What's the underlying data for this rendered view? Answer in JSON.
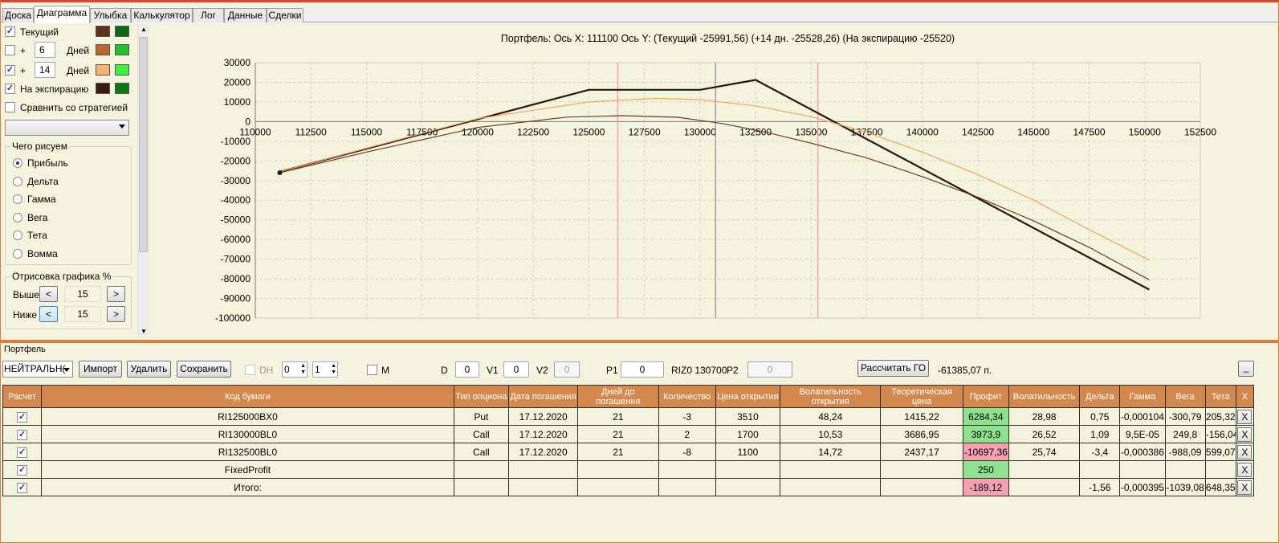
{
  "tabs": [
    "Доска",
    "Диаграмма",
    "Улыбка",
    "Калькулятор",
    "Лог",
    "Данные",
    "Сделки"
  ],
  "left": {
    "rows": [
      {
        "checked": true,
        "label": "Текущий",
        "c1": "#5b3418",
        "c2": "#0b6b14"
      },
      {
        "checked": false,
        "plus": "+",
        "days": "6",
        "label": "Дней",
        "c1": "#b8652f",
        "c2": "#1fc22a"
      },
      {
        "checked": true,
        "plus": "+",
        "days": "14",
        "label": "Дней",
        "c1": "#f8b06a",
        "c2": "#43f03c"
      },
      {
        "checked": true,
        "label": "На экспирацию",
        "c1": "#3a1d0e",
        "c2": "#0b7a16"
      }
    ],
    "compare_label": "Сравнить со стратегией",
    "draw_group": "Чего рисуем",
    "radios": [
      "Прибыль",
      "Дельта",
      "Гамма",
      "Вега",
      "Тета",
      "Вомма"
    ],
    "draw_pct_group": "Отрисовка графика %",
    "above_label": "Выше",
    "below_label": "Ниже",
    "above_val": "15",
    "below_val": "15",
    "lt": "<",
    "gt": ">"
  },
  "chart_data": {
    "type": "line",
    "title": "Портфель: Ось X: 111100 Ось Y:  (Текущий -25991,56)  (+14 дн. -25528,26)  (На экспирацию -25520)",
    "xlim": [
      110000,
      152500
    ],
    "ylim": [
      -100000,
      30000
    ],
    "xticks": [
      110000,
      112500,
      115000,
      117500,
      120000,
      122500,
      125000,
      127500,
      130000,
      132500,
      135000,
      137500,
      140000,
      142500,
      145000,
      147500,
      150000,
      152500
    ],
    "yticks": [
      30000,
      20000,
      10000,
      0,
      -10000,
      -20000,
      -30000,
      -40000,
      -50000,
      -60000,
      -70000,
      -80000,
      -90000,
      -100000
    ],
    "vlines": [
      {
        "x": 126300,
        "color": "#f0a0a0"
      },
      {
        "x": 130700,
        "color": "#9999aa"
      },
      {
        "x": 135300,
        "color": "#f0a0a0"
      }
    ],
    "series": [
      {
        "color": "#2a1608",
        "width": 2.2,
        "points": [
          [
            111100,
            -25520
          ],
          [
            125000,
            16200
          ],
          [
            130000,
            16200
          ],
          [
            132500,
            21200
          ],
          [
            150200,
            -85500
          ]
        ]
      },
      {
        "color": "#f5a25a",
        "width": 1.2,
        "points": [
          [
            111100,
            -25528
          ],
          [
            115000,
            -13500
          ],
          [
            120000,
            1500
          ],
          [
            125000,
            10000
          ],
          [
            128000,
            11800
          ],
          [
            130000,
            11200
          ],
          [
            132500,
            8000
          ],
          [
            135000,
            2500
          ],
          [
            137500,
            -5500
          ],
          [
            140000,
            -15500
          ],
          [
            142500,
            -27000
          ],
          [
            145000,
            -40000
          ],
          [
            147500,
            -55000
          ],
          [
            150200,
            -70500
          ]
        ]
      },
      {
        "color": "#6b3a1c",
        "width": 1.2,
        "points": [
          [
            111100,
            -25991
          ],
          [
            115000,
            -15500
          ],
          [
            120000,
            -3000
          ],
          [
            124000,
            2300
          ],
          [
            126500,
            3000
          ],
          [
            129000,
            2200
          ],
          [
            131000,
            -1000
          ],
          [
            133000,
            -5500
          ],
          [
            135000,
            -11000
          ],
          [
            137500,
            -18500
          ],
          [
            140000,
            -28000
          ],
          [
            142500,
            -38500
          ],
          [
            145000,
            -50500
          ],
          [
            147500,
            -64000
          ],
          [
            150200,
            -80500
          ]
        ]
      }
    ],
    "marker": [
      111100,
      -25991
    ]
  },
  "toolbar": {
    "strategy": "НЕЙТРАЛЬН(",
    "import": "Импорт",
    "delete": "Удалить",
    "save": "Сохранить",
    "dh": "DH",
    "spin1": "0",
    "spin2": "1",
    "m": "M",
    "d_label": "D",
    "d_val": "0",
    "v1_label": "V1",
    "v1_val": "0",
    "v2_label": "V2",
    "v2_val": "0",
    "p1_label": "P1",
    "p1_val": "0",
    "riz": "RIZ0 130700",
    "p2_label": "P2",
    "p2_val": "0",
    "calc_go": "Рассчитать ГО",
    "go_value": "-61385,07 п.",
    "min": "_"
  },
  "portfolio_label": "Портфель",
  "table": {
    "headers": [
      "Расчет",
      "Код бумаги",
      "Тип опциона",
      "Дата погашения",
      "Дней до погашения",
      "Количество",
      "Цена открытия",
      "Волатильность открытия",
      "Теоретическая цена",
      "Профит",
      "Волатильность",
      "Дельта",
      "Гамма",
      "Вега",
      "Тета",
      "X"
    ],
    "rows": [
      {
        "code": "RI125000BX0",
        "type": "Put",
        "date": "17.12.2020",
        "days": "21",
        "qty": "-3",
        "open": "3510",
        "vol_open": "48,24",
        "theo": "1415,22",
        "profit": "6284,34",
        "pc": "green",
        "vol": "28,98",
        "delta": "0,75",
        "gamma": "-0,000104",
        "vega": "-300,79",
        "theta": "205,32"
      },
      {
        "code": "RI130000BL0",
        "type": "Call",
        "date": "17.12.2020",
        "days": "21",
        "qty": "2",
        "open": "1700",
        "vol_open": "10,53",
        "theo": "3686,95",
        "profit": "3973,9",
        "pc": "green",
        "vol": "26,52",
        "delta": "1,09",
        "gamma": "9,5E-05",
        "vega": "249,8",
        "theta": "-156,04"
      },
      {
        "code": "RI132500BL0",
        "type": "Call",
        "date": "17.12.2020",
        "days": "21",
        "qty": "-8",
        "open": "1100",
        "vol_open": "14,72",
        "theo": "2437,17",
        "profit": "-10697,36",
        "pc": "red",
        "vol": "25,74",
        "delta": "-3,4",
        "gamma": "-0,000386",
        "vega": "-988,09",
        "theta": "599,07"
      },
      {
        "code": "FixedProfit",
        "type": "",
        "date": "",
        "days": "",
        "qty": "",
        "open": "",
        "vol_open": "",
        "theo": "",
        "profit": "250",
        "pc": "green",
        "vol": "",
        "delta": "",
        "gamma": "",
        "vega": "",
        "theta": ""
      },
      {
        "code": "Итого:",
        "type": "",
        "date": "",
        "days": "",
        "qty": "",
        "open": "",
        "vol_open": "",
        "theo": "",
        "profit": "-189,12",
        "pc": "red",
        "vol": "",
        "delta": "-1,56",
        "gamma": "-0,000395",
        "vega": "-1039,08",
        "theta": "648,35"
      }
    ],
    "x": "X"
  }
}
